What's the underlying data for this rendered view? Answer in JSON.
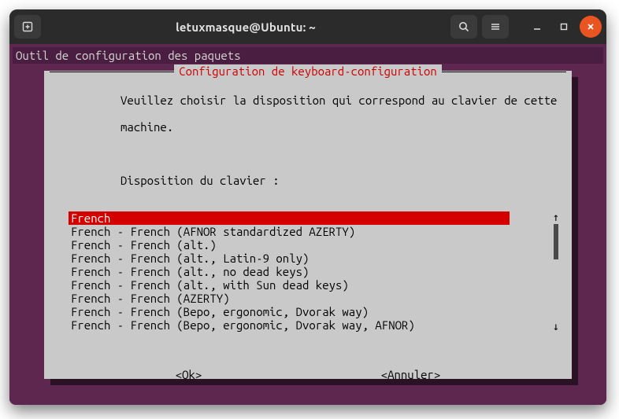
{
  "titlebar": {
    "title": "letuxmasque@Ubuntu: ~"
  },
  "terminal": {
    "header": "Outil de configuration des paquets"
  },
  "dialog": {
    "title": "Configuration de keyboard-configuration",
    "prompt_line1": "Veuillez choisir la disposition qui correspond au clavier de cette",
    "prompt_line2": "machine.",
    "field_label": "Disposition du clavier :",
    "items": [
      "French",
      "French - French (AFNOR standardized AZERTY)",
      "French - French (alt.)",
      "French - French (alt., Latin-9 only)",
      "French - French (alt., no dead keys)",
      "French - French (alt., with Sun dead keys)",
      "French - French (AZERTY)",
      "French - French (Bepo, ergonomic, Dvorak way)",
      "French - French (Bepo, ergonomic, Dvorak way, AFNOR)"
    ],
    "selected_index": 0,
    "ok_label": "<Ok>",
    "cancel_label": "<Annuler>"
  }
}
